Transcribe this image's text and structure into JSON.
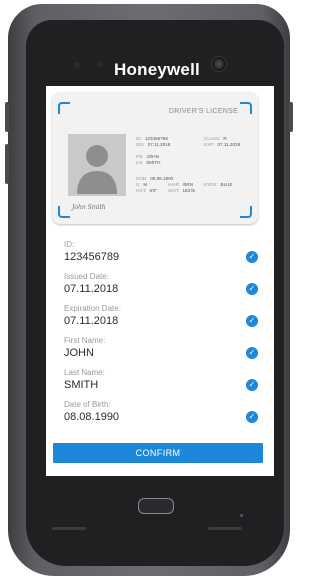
{
  "device": {
    "brand": "Honeywell"
  },
  "license": {
    "title": "DRIVER'S LICENSE",
    "signature": "John Smith",
    "details": {
      "id_key": "ID:",
      "id_val": "123456789",
      "class_key": "CLASS:",
      "class_val": "R",
      "iss_key": "ISS:",
      "iss_val": "07.11.2018",
      "exp_key": "EXP:",
      "exp_val": "07.11.2028",
      "fn_key": "FN:",
      "fn_val": "JOHN",
      "ln_key": "LN:",
      "ln_val": "SMITH",
      "dob_key": "DOB:",
      "dob_val": "08.08.1990",
      "sex_key": "S:",
      "sex_val": "M",
      "hair_key": "HAIR:",
      "hair_val": "BRN",
      "eyes_key": "EYES:",
      "eyes_val": "BLUE",
      "hgt_key": "HGT:",
      "hgt_val": "6'0\"",
      "wgt_key": "WGT:",
      "wgt_val": "183 lb"
    }
  },
  "fields": [
    {
      "label": "ID:",
      "value": "123456789"
    },
    {
      "label": "Issued Date:",
      "value": "07.11.2018"
    },
    {
      "label": "Expiration Date:",
      "value": "07.11.2018"
    },
    {
      "label": "First Name:",
      "value": "JOHN"
    },
    {
      "label": "Last Name:",
      "value": "SMITH"
    },
    {
      "label": "Date of Birth:",
      "value": "08.08.1990"
    }
  ],
  "check_glyph": "✓",
  "confirm_label": "CONFIRM",
  "colors": {
    "accent": "#1d88d9",
    "device_body": "#5e6063",
    "bezel": "#1f2022"
  }
}
